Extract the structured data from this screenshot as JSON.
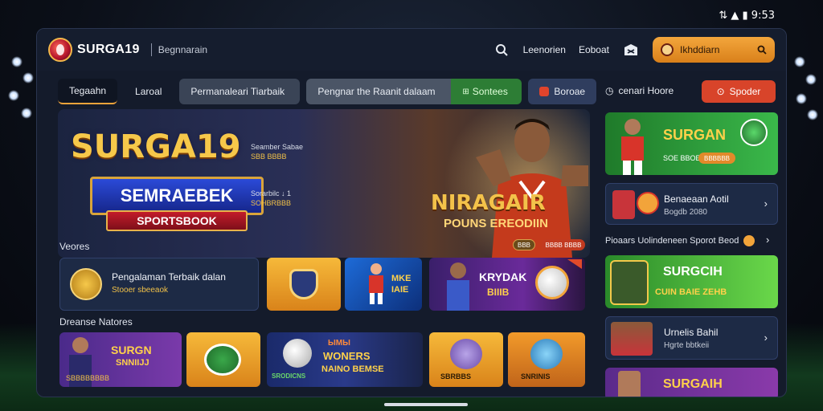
{
  "status_bar": {
    "text": "⇅ ▲ ▮ 9:53"
  },
  "header": {
    "logo_text": "SURGA19",
    "subtitle": "Begnnarain",
    "links": [
      "Leenorien",
      "Eoboat"
    ],
    "search_label": "Ikhddiarn"
  },
  "tabs": [
    {
      "label": "Tegaahn"
    },
    {
      "label": "Laroal"
    },
    {
      "label": "Permanaleari Tiarbaik"
    },
    {
      "label": "Pengnar the Raanit dalaam"
    },
    {
      "label": "Sontees"
    },
    {
      "label": "Boroae"
    }
  ],
  "sidebar_header": {
    "left_label": "cenari Hoore",
    "right_button": "Spoder"
  },
  "hero": {
    "brand": "SURGA19",
    "ribbon_main": "SEMRAEBEK",
    "ribbon_sub": "SPORTSBOOK",
    "small_1": "Seamber Sabae",
    "small_1b": "SBB BBBB",
    "small_2": "Sorarbilc ↓ 1",
    "small_2b": "SOHBRBBB",
    "caption_1": "NIRAGAIR",
    "caption_2": "POUNS EREODIIN",
    "mini_tag_1": "BBB",
    "mini_tag_2": "BBBB BBBB"
  },
  "section_1": {
    "label": "Veores"
  },
  "card_promo": {
    "text": "Pengalaman Terbaik dalan",
    "sub": "Stooer sbeeaok"
  },
  "card_kredak": {
    "title": "KRYDAK",
    "sub": "BIIIB"
  },
  "card_mide": {
    "line1": "MKE",
    "line2": "IAIE"
  },
  "section_2": {
    "label": "Dreanse Natores"
  },
  "card_surgan": {
    "title": "SURGN",
    "sub": "SNNIIJJ",
    "footer": "SBBBBBBBB"
  },
  "card_wonders": {
    "top": "ЫМЫ",
    "line1": "WONERS",
    "line2": "NAINO BEMSE",
    "corner": "SRODICNS"
  },
  "card_yel1": {
    "text": "SBRBBS"
  },
  "card_yel2": {
    "text": "SNRINIS"
  },
  "side_cards": [
    {
      "title": "SURGAN",
      "sub": "SOE BBOE",
      "button": "BBBBBB"
    },
    {
      "title": "Benaeaan Aotil",
      "sub": "Bogdb 2080"
    },
    {
      "title": "SURGCIH",
      "sub": "CUIN BAIE ZEHB"
    },
    {
      "title": "Urnelis Bahil",
      "sub": "Hgrte bbtkeii"
    },
    {
      "title": "SURGAIH"
    }
  ],
  "side_section_label": "Pioaars Uolindeneen Sporot Beod",
  "colors": {
    "accent_orange": "#f2a43a",
    "green": "#2d7d35",
    "red_button": "#d8442a",
    "panel": "#141b2b"
  }
}
